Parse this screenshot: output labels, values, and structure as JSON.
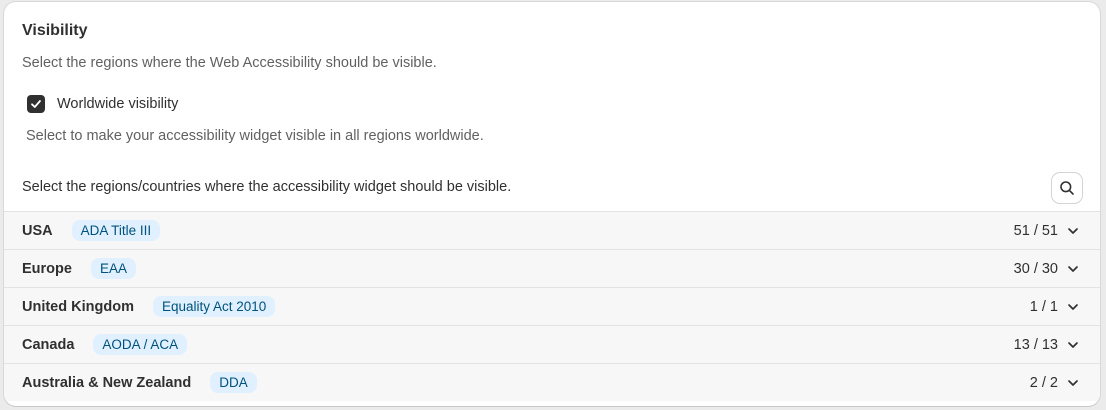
{
  "visibility": {
    "title": "Visibility",
    "subtitle": "Select the regions where the Web Accessibility should be visible.",
    "worldwide": {
      "label": "Worldwide visibility",
      "checked": true,
      "help": "Select to make your accessibility widget visible in all regions worldwide."
    },
    "regions_header": "Select the regions/countries where the accessibility widget should be visible.",
    "search_icon": "search-icon",
    "regions": [
      {
        "name": "USA",
        "badge": "ADA Title III",
        "count": "51 / 51"
      },
      {
        "name": "Europe",
        "badge": "EAA",
        "count": "30 / 30"
      },
      {
        "name": "United Kingdom",
        "badge": "Equality Act 2010",
        "count": "1 / 1"
      },
      {
        "name": "Canada",
        "badge": "AODA / ACA",
        "count": "13 / 13"
      },
      {
        "name": "Australia & New Zealand",
        "badge": "DDA",
        "count": "2 / 2"
      }
    ]
  },
  "colors": {
    "checkbox_fill": "#303030",
    "badge_bg": "#e0f0ff",
    "badge_text": "#00527c",
    "row_bg": "#f7f7f7"
  }
}
